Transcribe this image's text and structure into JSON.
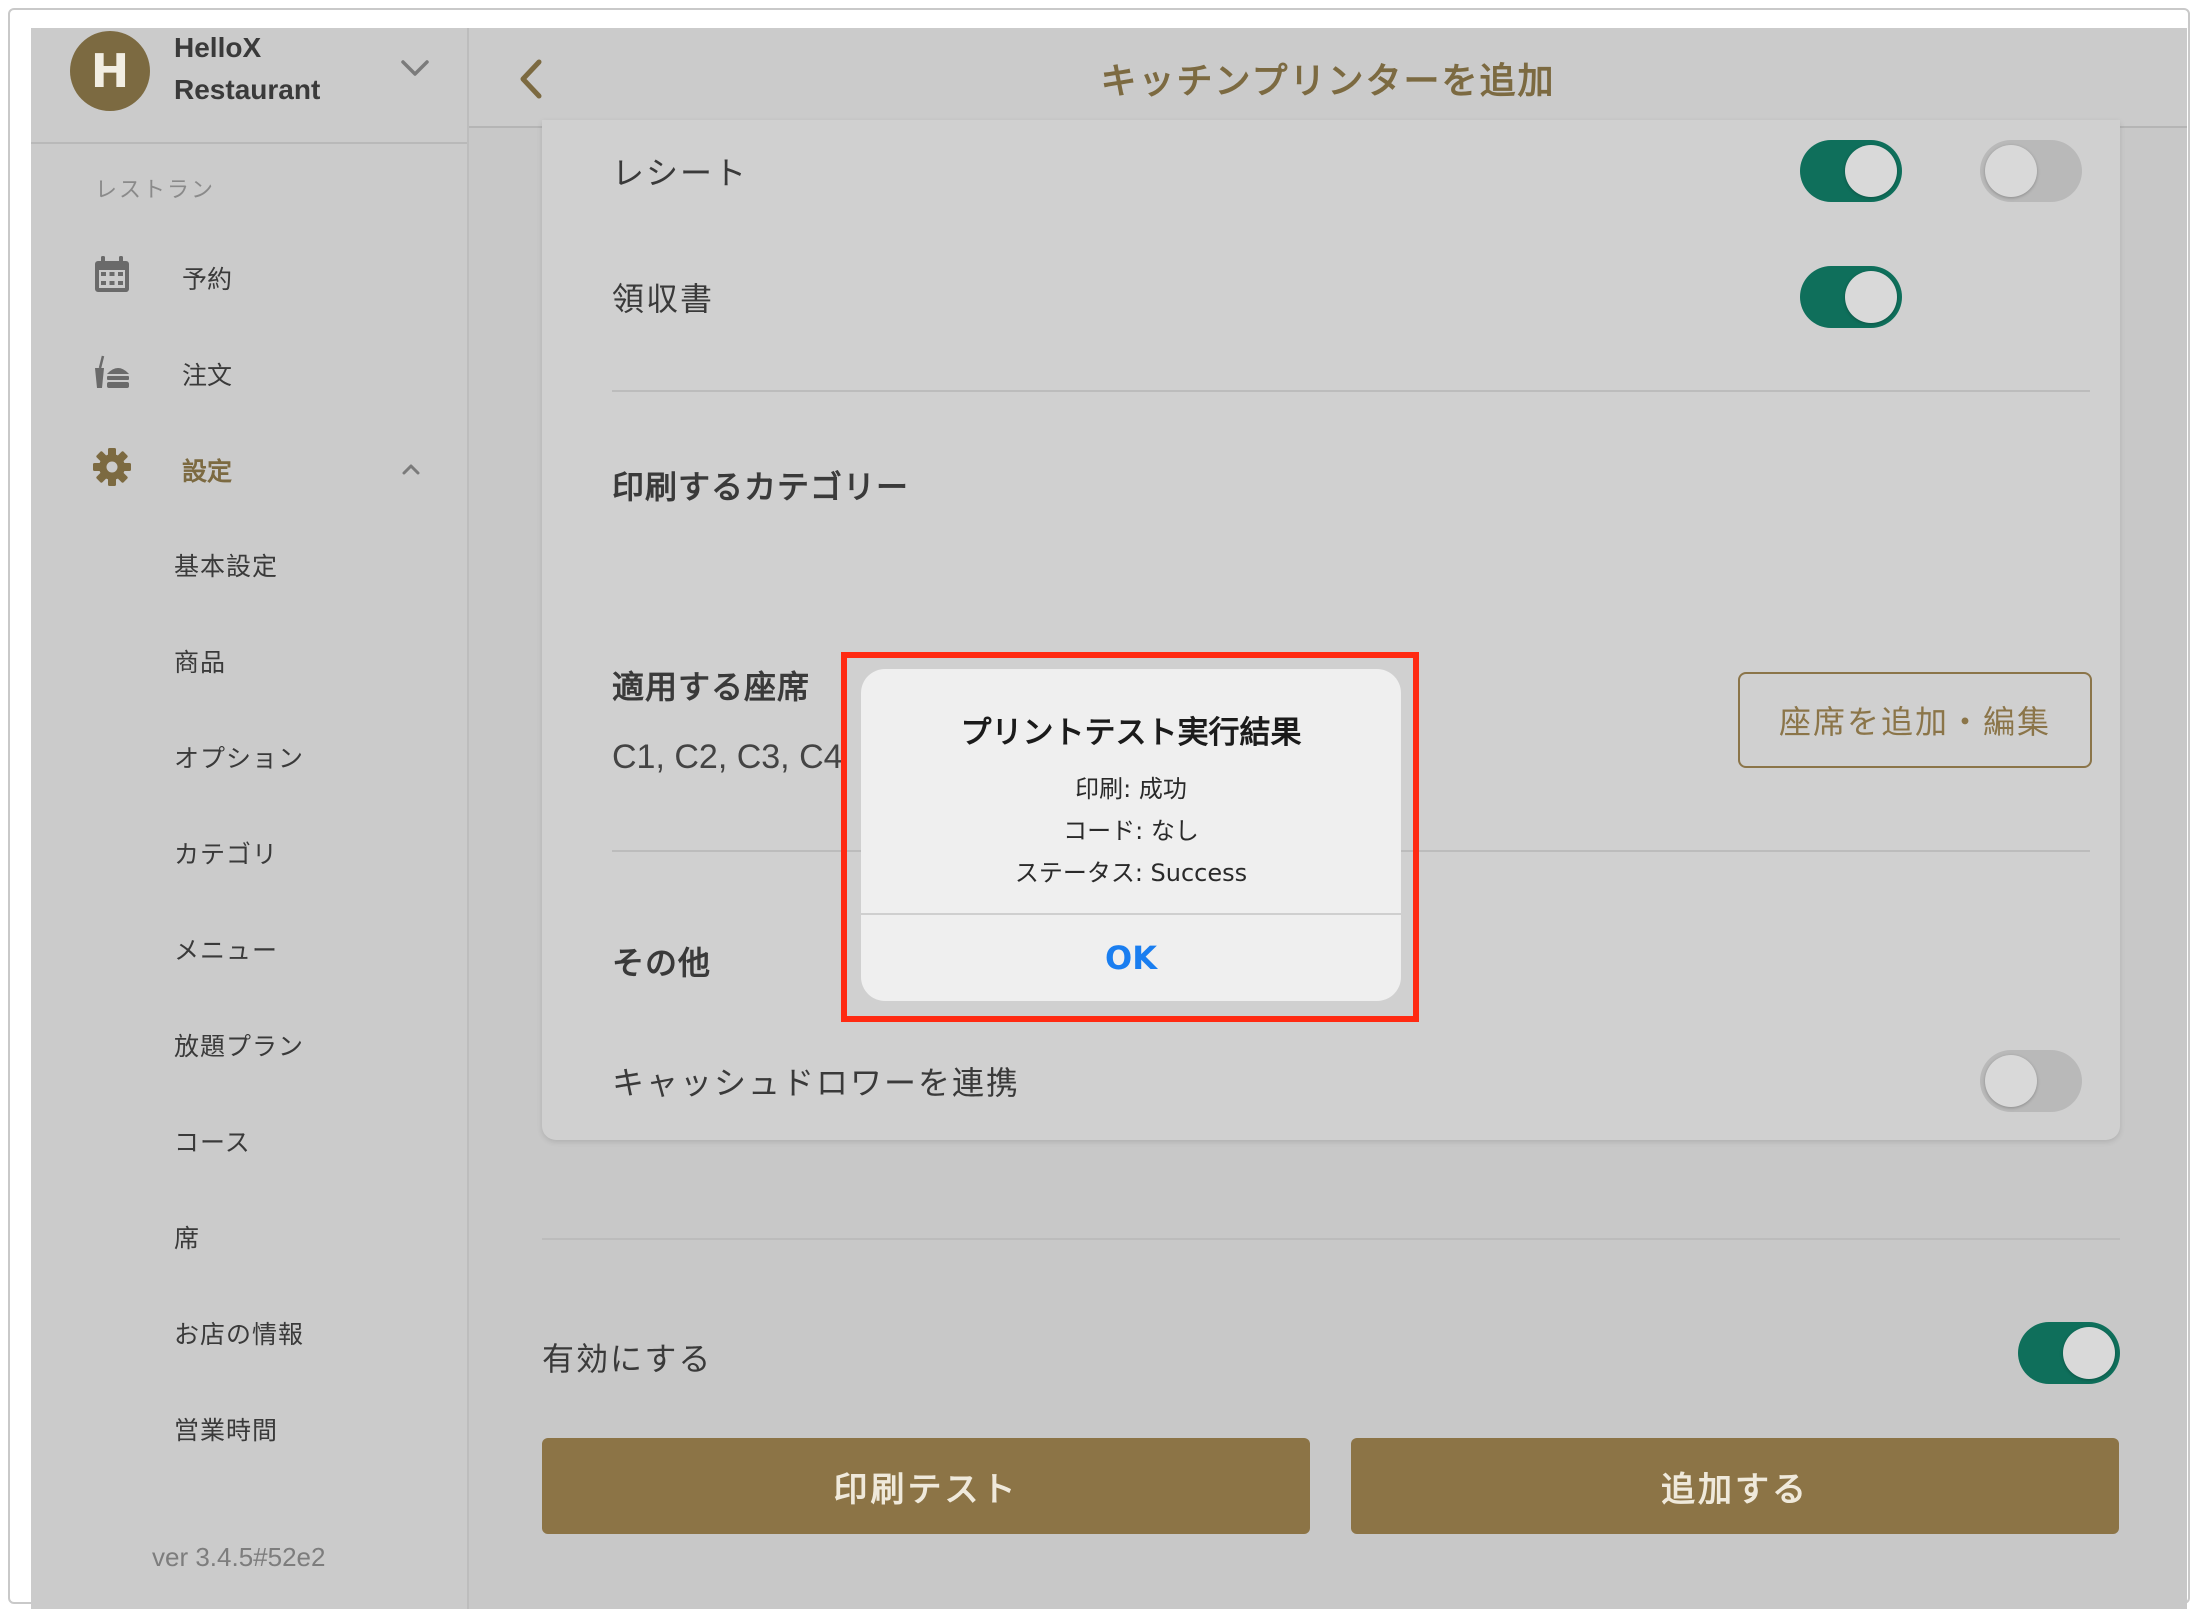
{
  "app": {
    "restaurant_initial": "H",
    "restaurant_name_line1": "HelloX",
    "restaurant_name_line2": "Restaurant"
  },
  "sidebar": {
    "section_label": "レストラン",
    "main_items": [
      {
        "label": "予約",
        "icon": "calendar-icon"
      },
      {
        "label": "注文",
        "icon": "food-order-icon"
      },
      {
        "label": "設定",
        "icon": "gear-icon",
        "active": true
      }
    ],
    "settings_items": [
      "基本設定",
      "商品",
      "オプション",
      "カテゴリ",
      "メニュー",
      "放題プラン",
      "コース",
      "席",
      "お店の情報",
      "営業時間"
    ],
    "version": "ver 3.4.5#52e2"
  },
  "topbar": {
    "title": "キッチンプリンターを追加",
    "back_icon": "chevron-left-icon"
  },
  "content": {
    "receipt_row": {
      "label": "レシート",
      "toggle1_on": true,
      "toggle2_on": false
    },
    "invoice_row": {
      "label": "領収書",
      "toggle_on": true
    },
    "categories_title": "印刷するカテゴリー",
    "seats_title": "適用する座席",
    "seats_value": "C1, C2, C3, C4",
    "seats_button": "座席を追加・編集",
    "other_title": "その他",
    "cash_drawer": {
      "label": "キャッシュドロワーを連携",
      "toggle_on": false
    },
    "enable": {
      "label": "有効にする",
      "toggle_on": true
    },
    "print_test_button": "印刷テスト",
    "add_button": "追加する"
  },
  "alert": {
    "title": "プリントテスト実行結果",
    "line1": "印刷: 成功",
    "line2": "コード: なし",
    "line3": "ステータス: Success",
    "ok": "OK"
  },
  "colors": {
    "brand": "#7c6a41",
    "toggle_on": "#0f6f5b",
    "highlight": "#ff2a12",
    "ios_blue": "#1a7ef0"
  }
}
